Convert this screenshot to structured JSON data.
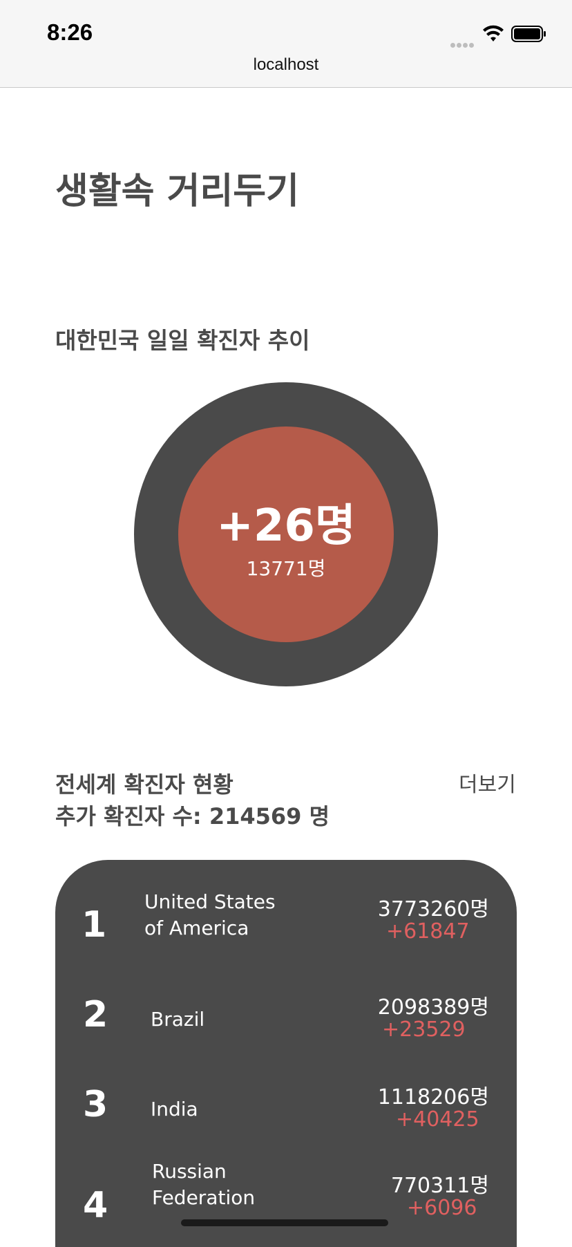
{
  "status_bar": {
    "time": "8:26",
    "url": "localhost"
  },
  "page_title": "생활속 거리두기",
  "korea": {
    "section_title": "대한민국 일일 확진자 추이",
    "delta": "+26명",
    "total": "13771명"
  },
  "world": {
    "title": "전세계 확진자 현황",
    "subtitle": "추가 확진자 수: 214569 명",
    "more_label": "더보기",
    "rows": [
      {
        "rank": "1",
        "country": "United States of America",
        "count": "3773260명",
        "change": "+61847"
      },
      {
        "rank": "2",
        "country": "Brazil",
        "count": "2098389명",
        "change": "+23529"
      },
      {
        "rank": "3",
        "country": "India",
        "count": "1118206명",
        "change": "+40425"
      },
      {
        "rank": "4",
        "country": "Russian Federation",
        "count": "770311명",
        "change": "+6096"
      }
    ]
  },
  "colors": {
    "dark": "#4a4a4a",
    "accent": "#b55b4a",
    "increase": "#e06060"
  }
}
